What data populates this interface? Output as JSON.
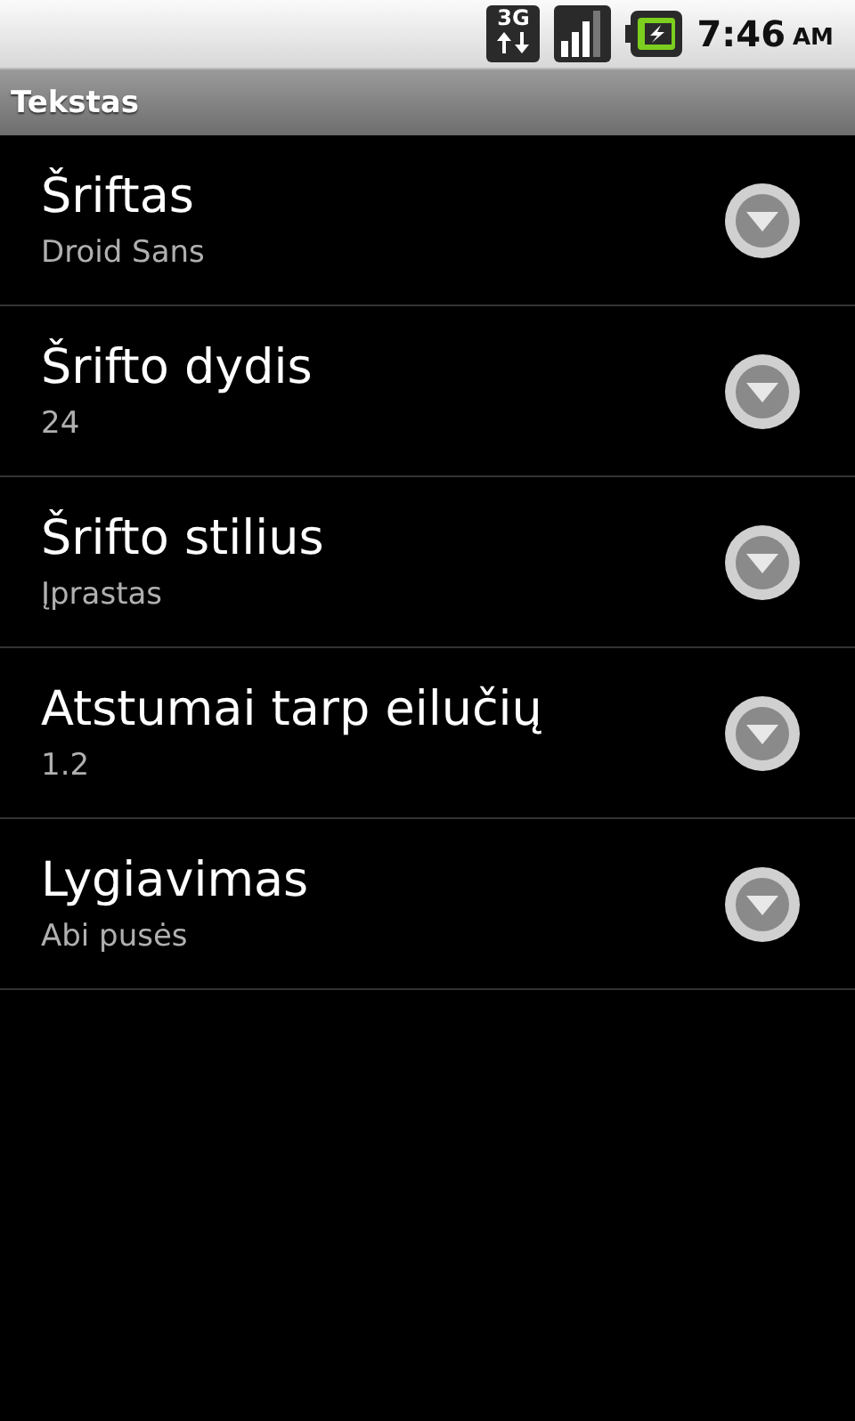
{
  "status_bar": {
    "network_type": "3G",
    "time": "7:46",
    "meridiem": "AM"
  },
  "title_bar": {
    "title": "Tekstas"
  },
  "preferences": [
    {
      "title": "Šriftas",
      "summary": "Droid Sans"
    },
    {
      "title": "Šrifto dydis",
      "summary": "24"
    },
    {
      "title": "Šrifto stilius",
      "summary": "Įprastas"
    },
    {
      "title": "Atstumai tarp eilučių",
      "summary": "1.2"
    },
    {
      "title": "Lygiavimas",
      "summary": "Abi pusės"
    }
  ]
}
